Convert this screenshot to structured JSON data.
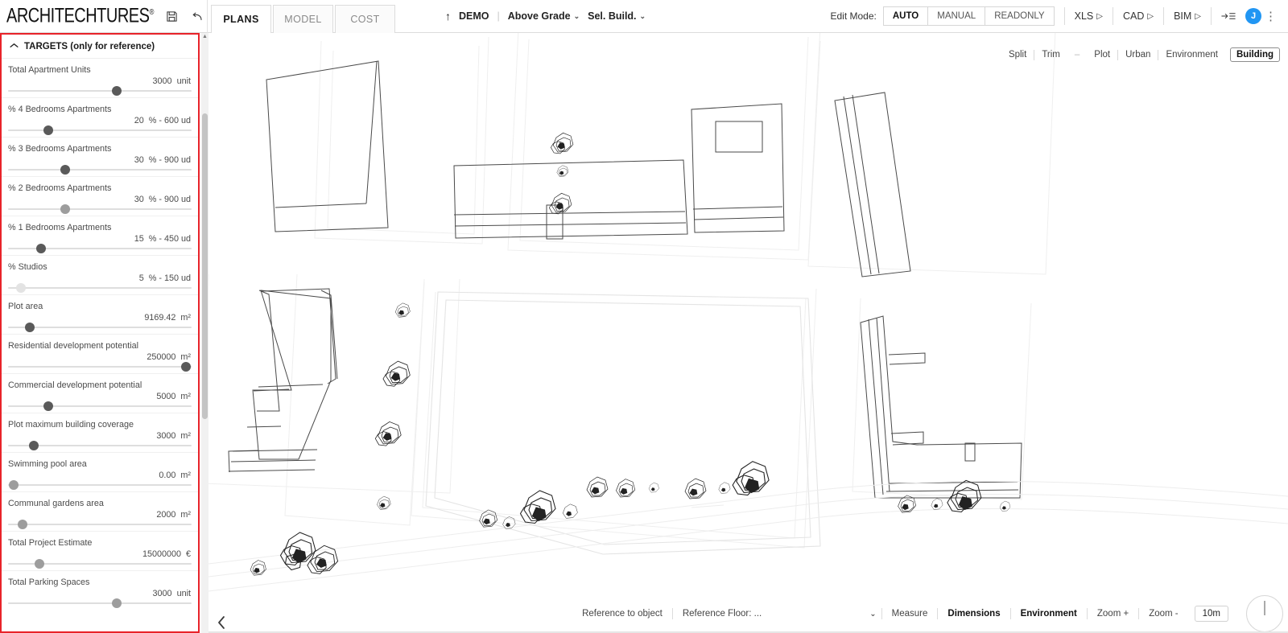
{
  "brand": {
    "name": "ARCHITECHTURES",
    "trademark": "®",
    "save_icon": "save-icon",
    "undo_icon": "undo-icon",
    "redo_icon": "redo-icon"
  },
  "tabs": [
    {
      "label": "PLANS",
      "active": true
    },
    {
      "label": "MODEL",
      "active": false
    },
    {
      "label": "COST",
      "active": false
    }
  ],
  "center_nav": {
    "up_arrow": "↑",
    "project": "DEMO",
    "separator": "|",
    "level": "Above Grade",
    "selection": "Sel. Build.",
    "caret": "⌄"
  },
  "edit_mode": {
    "label": "Edit Mode:",
    "options": [
      "AUTO",
      "MANUAL",
      "READONLY"
    ],
    "selected": "AUTO"
  },
  "exports": [
    {
      "label": "XLS",
      "glyph": "▷"
    },
    {
      "label": "CAD",
      "glyph": "▷"
    },
    {
      "label": "BIM",
      "glyph": "▷"
    }
  ],
  "account": {
    "panel_icon": "panel-toggle-icon",
    "avatar_initial": "J",
    "avatar_color": "#2196f3",
    "kebab": "⋮"
  },
  "sidebar": {
    "header": "TARGETS (only for reference)",
    "collapse_icon": "chevron-up-icon",
    "border_color": "#e8232a",
    "sliders": [
      {
        "label": "Total Apartment Units",
        "value": "3000",
        "unit": "unit",
        "pct": 59
      },
      {
        "label": "% 4 Bedrooms Apartments",
        "value": "20",
        "unit": "% - 600 ud",
        "pct": 22
      },
      {
        "label": "% 3 Bedrooms Apartments",
        "value": "30",
        "unit": "% - 900 ud",
        "pct": 31
      },
      {
        "label": "% 2 Bedrooms Apartments",
        "value": "30",
        "unit": "% - 900 ud",
        "pct": 31
      },
      {
        "label": "% 1 Bedrooms Apartments",
        "value": "15",
        "unit": "% - 450 ud",
        "pct": 18
      },
      {
        "label": "% Studios",
        "value": "5",
        "unit": "% - 150 ud",
        "pct": 7
      },
      {
        "label": "Plot area",
        "value": "9169.42",
        "unit": "m²",
        "pct": 12
      },
      {
        "label": "Residential development potential",
        "value": "250000",
        "unit": "m²",
        "pct": 97
      },
      {
        "label": "Commercial development potential",
        "value": "5000",
        "unit": "m²",
        "pct": 22
      },
      {
        "label": "Plot maximum building coverage",
        "value": "3000",
        "unit": "m²",
        "pct": 14
      },
      {
        "label": "Swimming pool area",
        "value": "0.00",
        "unit": "m²",
        "pct": 3
      },
      {
        "label": "Communal gardens area",
        "value": "2000",
        "unit": "m²",
        "pct": 8
      },
      {
        "label": "Total Project Estimate",
        "value": "15000000",
        "unit": "€",
        "pct": 17
      },
      {
        "label": "Total Parking Spaces",
        "value": "3000",
        "unit": "unit",
        "pct": 59
      }
    ]
  },
  "view_tools": {
    "items": [
      "Split",
      "Trim"
    ],
    "dash": "–",
    "layers": [
      "Plot",
      "Urban",
      "Environment"
    ],
    "active_layer": "Building"
  },
  "bottom_bar": {
    "reference_to_object": "Reference to object",
    "reference_floor_label": "Reference Floor:",
    "reference_floor_value": "...",
    "dropdown_caret": "⌄",
    "measure": "Measure",
    "dimensions": "Dimensions",
    "environment": "Environment",
    "zoom_in": "Zoom +",
    "zoom_out": "Zoom -",
    "scale": "10m",
    "compass": "compass-dial",
    "collapse_panel_icon": "chevron-left-icon"
  }
}
